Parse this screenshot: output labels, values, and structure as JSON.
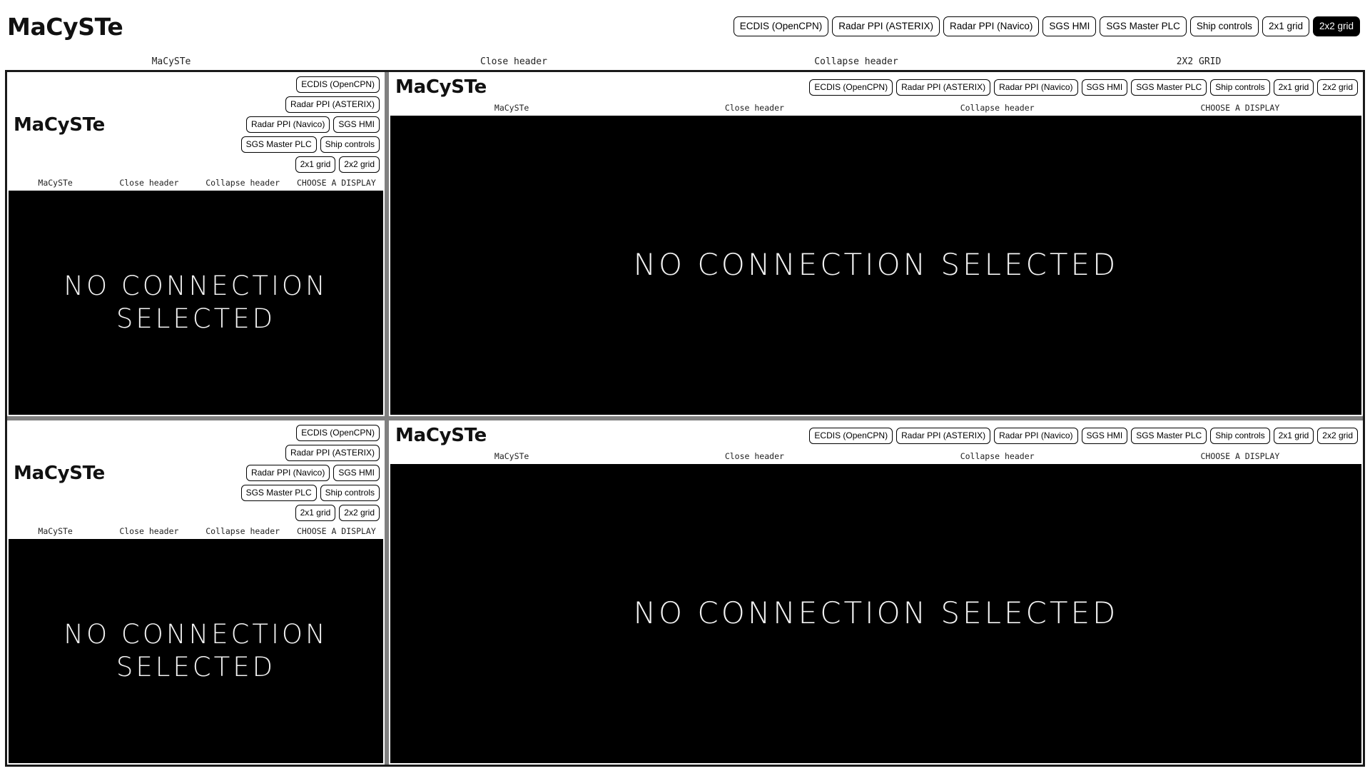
{
  "app": {
    "title": "MaCySTe",
    "accent_color": "#000000",
    "background_color": "#ffffff",
    "divider_color": "#808080",
    "screen_color": "#000000"
  },
  "toolbar": {
    "buttons": [
      {
        "label": "ECDIS (OpenCPN)",
        "active": false
      },
      {
        "label": "Radar PPI (ASTERIX)",
        "active": false
      },
      {
        "label": "Radar PPI (Navico)",
        "active": false
      },
      {
        "label": "SGS HMI",
        "active": false
      },
      {
        "label": "SGS Master PLC",
        "active": false
      },
      {
        "label": "Ship controls",
        "active": false
      },
      {
        "label": "2x1 grid",
        "active": false
      },
      {
        "label": "2x2 grid",
        "active": true
      }
    ]
  },
  "hint_strip": {
    "labels": [
      "MaCySTe",
      "Close header",
      "Collapse header",
      "2X2 GRID"
    ]
  },
  "panel_common": {
    "title": "MaCySTe",
    "buttons": [
      "ECDIS (OpenCPN)",
      "Radar PPI (ASTERIX)",
      "Radar PPI (Navico)",
      "SGS HMI",
      "SGS Master PLC",
      "Ship controls",
      "2x1 grid",
      "2x2 grid"
    ],
    "labels": [
      "MaCySTe",
      "Close header",
      "Collapse header",
      "CHOOSE A DISPLAY"
    ],
    "message": "NO CONNECTION SELECTED"
  },
  "panels": [
    {
      "id": "top-left",
      "size": "narrow"
    },
    {
      "id": "top-right",
      "size": "wide"
    },
    {
      "id": "bottom-left",
      "size": "narrow"
    },
    {
      "id": "bottom-right",
      "size": "wide"
    }
  ]
}
